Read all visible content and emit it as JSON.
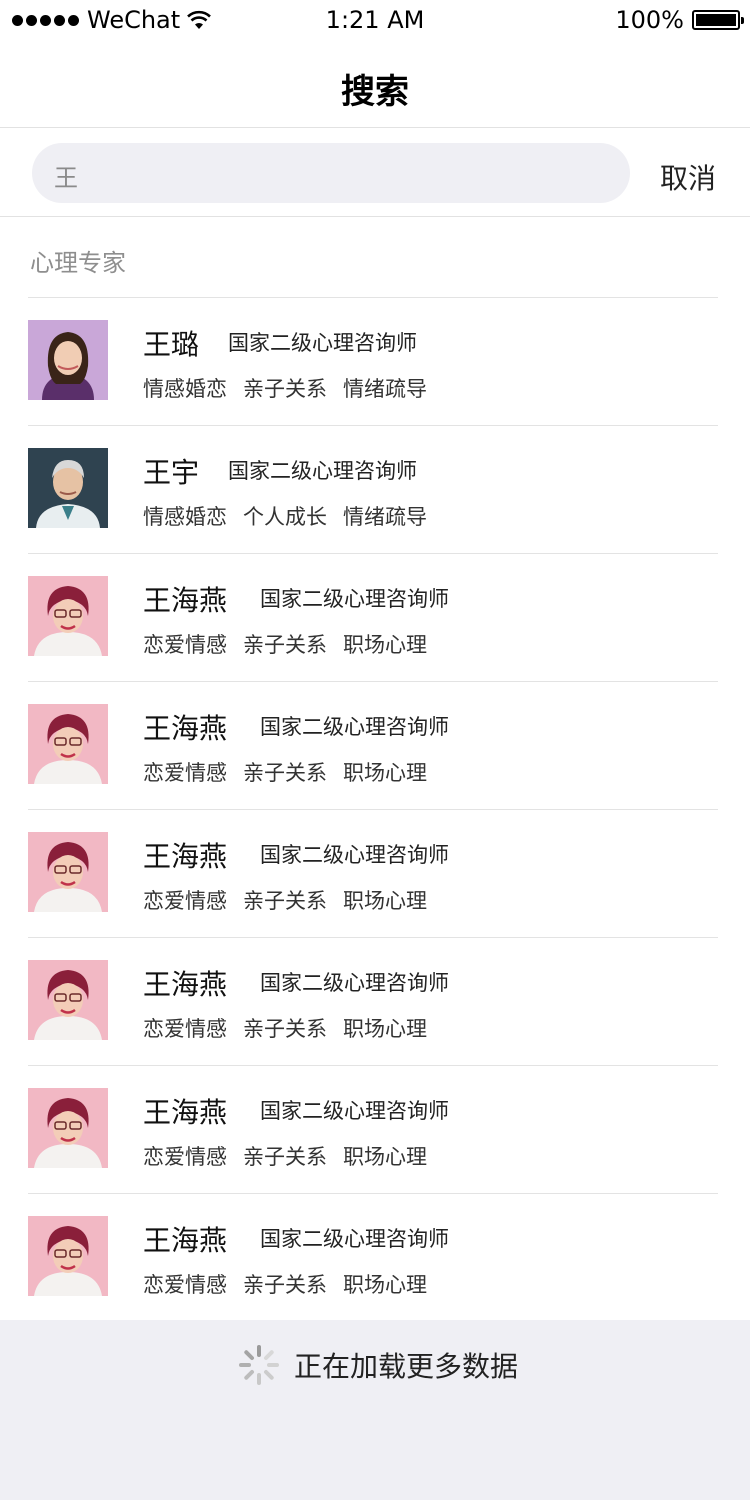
{
  "status_bar": {
    "carrier": "WeChat",
    "time": "1:21 AM",
    "battery": "100%"
  },
  "nav": {
    "title": "搜索"
  },
  "search": {
    "query": "王",
    "cancel_label": "取消"
  },
  "section": {
    "title": "心理专家"
  },
  "experts": [
    {
      "name": "王璐",
      "title": "国家二级心理咨询师",
      "tags": [
        "情感婚恋",
        "亲子关系",
        "情绪疏导"
      ]
    },
    {
      "name": "王宇",
      "title": "国家二级心理咨询师",
      "tags": [
        "情感婚恋",
        "个人成长",
        "情绪疏导"
      ]
    },
    {
      "name": "王海燕",
      "title": "国家二级心理咨询师",
      "tags": [
        "恋爱情感",
        "亲子关系",
        "职场心理"
      ]
    },
    {
      "name": "王海燕",
      "title": "国家二级心理咨询师",
      "tags": [
        "恋爱情感",
        "亲子关系",
        "职场心理"
      ]
    },
    {
      "name": "王海燕",
      "title": "国家二级心理咨询师",
      "tags": [
        "恋爱情感",
        "亲子关系",
        "职场心理"
      ]
    },
    {
      "name": "王海燕",
      "title": "国家二级心理咨询师",
      "tags": [
        "恋爱情感",
        "亲子关系",
        "职场心理"
      ]
    },
    {
      "name": "王海燕",
      "title": "国家二级心理咨询师",
      "tags": [
        "恋爱情感",
        "亲子关系",
        "职场心理"
      ]
    },
    {
      "name": "王海燕",
      "title": "国家二级心理咨询师",
      "tags": [
        "恋爱情感",
        "亲子关系",
        "职场心理"
      ]
    }
  ],
  "loading": {
    "text": "正在加载更多数据"
  },
  "colors": {
    "search_bg": "#efeff4",
    "divider": "#e3e3e3",
    "loading_bg": "#efeff4",
    "section_gray": "#8e8e8e"
  }
}
